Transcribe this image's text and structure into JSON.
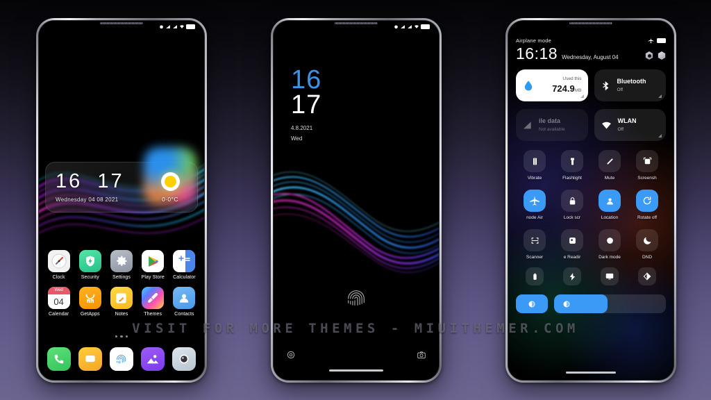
{
  "watermark": "VISIT FOR MORE THEMES - MIUITHEMER.COM",
  "background": {
    "top_color": "#050507",
    "bottom_color": "#6b6590"
  },
  "phone1": {
    "name": "home-screen",
    "statusbar": {
      "icons": [
        "alarm-icon",
        "signal-icon",
        "signal-icon",
        "wifi-icon",
        "battery-icon"
      ]
    },
    "widget": {
      "hours": "16",
      "minutes": "17",
      "date": "Wednesday 04 08 2021",
      "temperature": "0·0°C",
      "weather_icon": "sun-icon"
    },
    "apps": [
      {
        "label": "Clock",
        "icon": "clock-icon"
      },
      {
        "label": "Security",
        "icon": "shield-icon"
      },
      {
        "label": "Settings",
        "icon": "gear-icon"
      },
      {
        "label": "Play Store",
        "icon": "play-store-icon"
      },
      {
        "label": "Calculator",
        "icon": "calculator-icon"
      },
      {
        "label": "Calendar",
        "icon": "calendar-icon",
        "day_name": "Wed",
        "day_number": "04"
      },
      {
        "label": "GetApps",
        "icon": "getapps-icon"
      },
      {
        "label": "Notes",
        "icon": "notes-icon"
      },
      {
        "label": "Themes",
        "icon": "themes-icon"
      },
      {
        "label": "Contacts",
        "icon": "contacts-icon"
      }
    ],
    "dock": [
      {
        "label": "Phone",
        "icon": "phone-icon"
      },
      {
        "label": "Messages",
        "icon": "messages-icon"
      },
      {
        "label": "Scanner",
        "icon": "fingerprint-icon"
      },
      {
        "label": "Gallery",
        "icon": "gallery-icon"
      },
      {
        "label": "Camera",
        "icon": "camera-icon"
      }
    ],
    "page_dots": 3
  },
  "phone2": {
    "name": "lock-screen",
    "statusbar": {
      "icons": [
        "alarm-icon",
        "signal-icon",
        "signal-icon",
        "wifi-icon",
        "battery-icon"
      ]
    },
    "clock": {
      "hours": "16",
      "minutes": "17",
      "date": "4.8.2021",
      "weekday": "Wed",
      "hours_color": "#3b93e8",
      "minutes_color": "#ffffff"
    },
    "fingerprint_icon": "fingerprint-icon",
    "shortcut_left": "flashlight-icon",
    "shortcut_right": "camera-icon"
  },
  "phone3": {
    "name": "control-center",
    "statusbar": {
      "airplane_label": "Airplane mode",
      "icons": [
        "airplane-icon",
        "battery-icon"
      ]
    },
    "header": {
      "time": "16:18",
      "date": "Wednesday, August 04",
      "icons": [
        "settings-hex-icon",
        "user-hex-icon"
      ]
    },
    "big_tiles": [
      {
        "title": "Used this",
        "value": "724.9",
        "unit": "MB",
        "state": "on",
        "icon": "data-drop-icon"
      },
      {
        "title": "Bluetooth",
        "value": "Off",
        "unit": "",
        "state": "off",
        "icon": "bluetooth-icon"
      },
      {
        "title": "ile data",
        "value": "Not available",
        "unit": "",
        "state": "disabled",
        "icon": "mobile-data-icon"
      },
      {
        "title": "WLAN",
        "value": "Off",
        "unit": "",
        "state": "off",
        "icon": "wifi-icon"
      }
    ],
    "toggles_row1": [
      {
        "label": "Vibrate",
        "icon": "vibrate-icon",
        "active": false
      },
      {
        "label": "Flashlight",
        "icon": "flashlight-icon",
        "active": false
      },
      {
        "label": "Mute",
        "icon": "mute-icon",
        "active": false
      },
      {
        "label": "Screensh",
        "icon": "screenshot-icon",
        "active": false
      }
    ],
    "toggles_row2": [
      {
        "label": "node  Air",
        "icon": "airplane-icon",
        "active": true
      },
      {
        "label": "Lock scr",
        "icon": "lock-icon",
        "active": false
      },
      {
        "label": "Location",
        "icon": "location-icon",
        "active": true
      },
      {
        "label": "Rotate off",
        "icon": "rotate-icon",
        "active": true
      }
    ],
    "toggles_row3": [
      {
        "label": "Scanner",
        "icon": "scanner-icon",
        "active": false
      },
      {
        "label": "e  Readir",
        "icon": "reading-icon",
        "active": false
      },
      {
        "label": "Dark mode",
        "icon": "dark-mode-icon",
        "active": false
      },
      {
        "label": "DND",
        "icon": "moon-icon",
        "active": false
      }
    ],
    "toggles_row4": [
      {
        "label": "",
        "icon": "battery-saver-icon",
        "active": false
      },
      {
        "label": "",
        "icon": "lightning-icon",
        "active": false
      },
      {
        "label": "",
        "icon": "cast-icon",
        "active": false
      },
      {
        "label": "",
        "icon": "contrast-icon",
        "active": false
      }
    ],
    "sliders": {
      "left_icon": "brightness-icon",
      "bar_icon": "brightness-icon",
      "fill_percent": 48,
      "accent": "#3b9af5"
    }
  }
}
